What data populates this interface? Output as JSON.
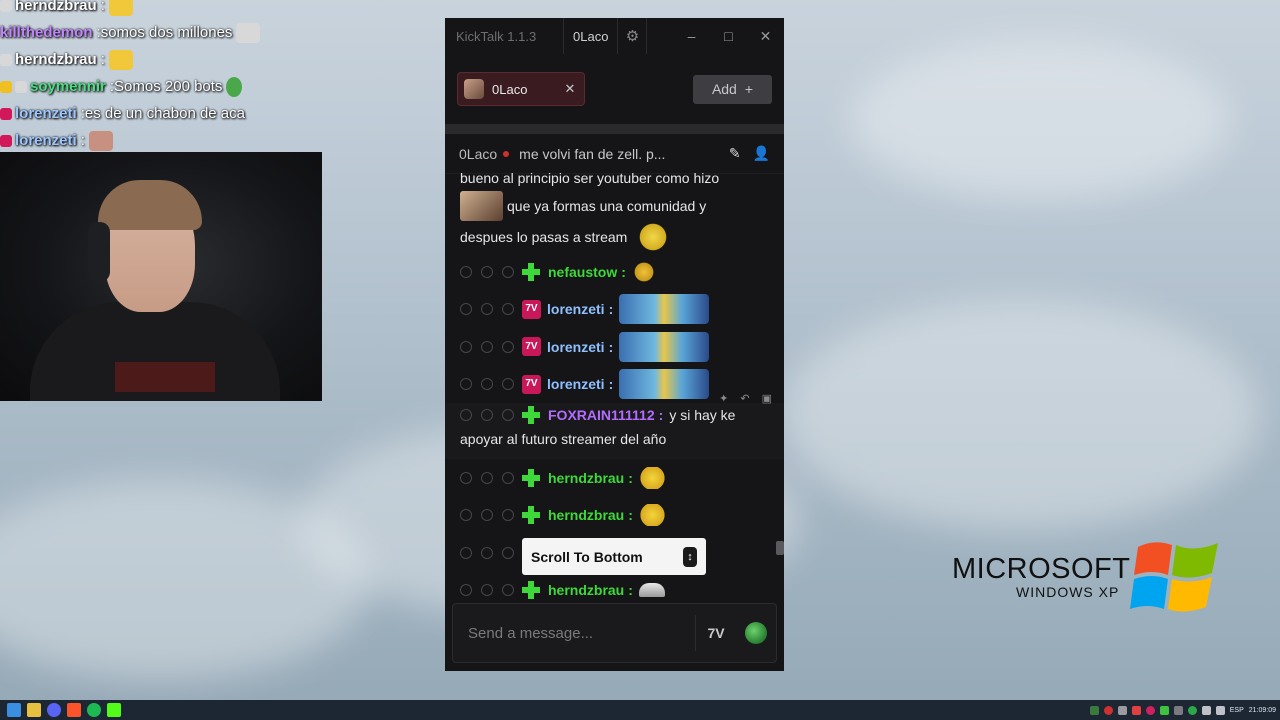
{
  "overlay_chat": [
    {
      "name": "herndzbrau",
      "name_color": "#ffffff",
      "text": "",
      "badges": [
        "gift"
      ]
    },
    {
      "name": "killthedemon",
      "name_color": "#c084fc",
      "text": " somos dos millones",
      "badges": []
    },
    {
      "name": "herndzbrau",
      "name_color": "#ffffff",
      "text": "",
      "badges": [
        "gift"
      ]
    },
    {
      "name": "soymennir",
      "name_color": "#4ade80",
      "text": " Somos 200 bots",
      "badges": [
        "coin",
        "gift"
      ]
    },
    {
      "name": "lorenzeti",
      "name_color": "#9ec6ff",
      "text": " es de un chabon de aca",
      "badges": [
        "7tv"
      ]
    },
    {
      "name": "lorenzeti",
      "name_color": "#9ec6ff",
      "text": "",
      "badges": [
        "7tv"
      ]
    }
  ],
  "kicktalk": {
    "app_title": "KickTalk 1.1.3",
    "current_user": "0Laco",
    "window_buttons": {
      "minimize": "–",
      "maximize": "□",
      "close": "✕"
    },
    "tabs": [
      {
        "label": "0Laco",
        "close": "✕"
      }
    ],
    "add_label": "Add",
    "add_icon": "+",
    "chat_header": {
      "channel": "0Laco",
      "stream_title": "me volvi fan de zell. p..."
    },
    "messages": [
      {
        "type": "continuation",
        "text_1": "bueno al principio ser youtuber como hizo",
        "text_2": "que ya formas una comunidad y",
        "text_3": "despues lo pasas a stream"
      },
      {
        "user": "nefaustow",
        "color": "#3fd83a",
        "badge": "green",
        "text": ""
      },
      {
        "user": "lorenzeti",
        "color": "#8ec0ff",
        "badge": "7tv",
        "text": ""
      },
      {
        "user": "lorenzeti",
        "color": "#8ec0ff",
        "badge": "7tv",
        "text": ""
      },
      {
        "user": "lorenzeti",
        "color": "#8ec0ff",
        "badge": "7tv",
        "text": ""
      },
      {
        "user": "FOXRAIN111112",
        "color": "#b46cff",
        "badge": "green",
        "text_1": "y si hay ke",
        "text_2": "apoyar al futuro streamer del año"
      },
      {
        "user": "herndzbrau",
        "color": "#3fd83a",
        "badge": "green",
        "text": ""
      },
      {
        "user": "herndzbrau",
        "color": "#3fd83a",
        "badge": "green",
        "text": ""
      },
      {
        "user": "",
        "color": "#3fd83a",
        "badge": "",
        "text": ""
      },
      {
        "user": "herndzbrau",
        "color": "#3fd83a",
        "badge": "green",
        "text": ""
      }
    ],
    "scroll_to_bottom": "Scroll To Bottom",
    "input_placeholder": "Send a message..."
  },
  "desktop": {
    "brand_line_1": "MICROSOFT",
    "brand_line_2": "WINDOWS XP"
  },
  "taskbar": {
    "lang": "ESP",
    "time": "21:09:09"
  }
}
